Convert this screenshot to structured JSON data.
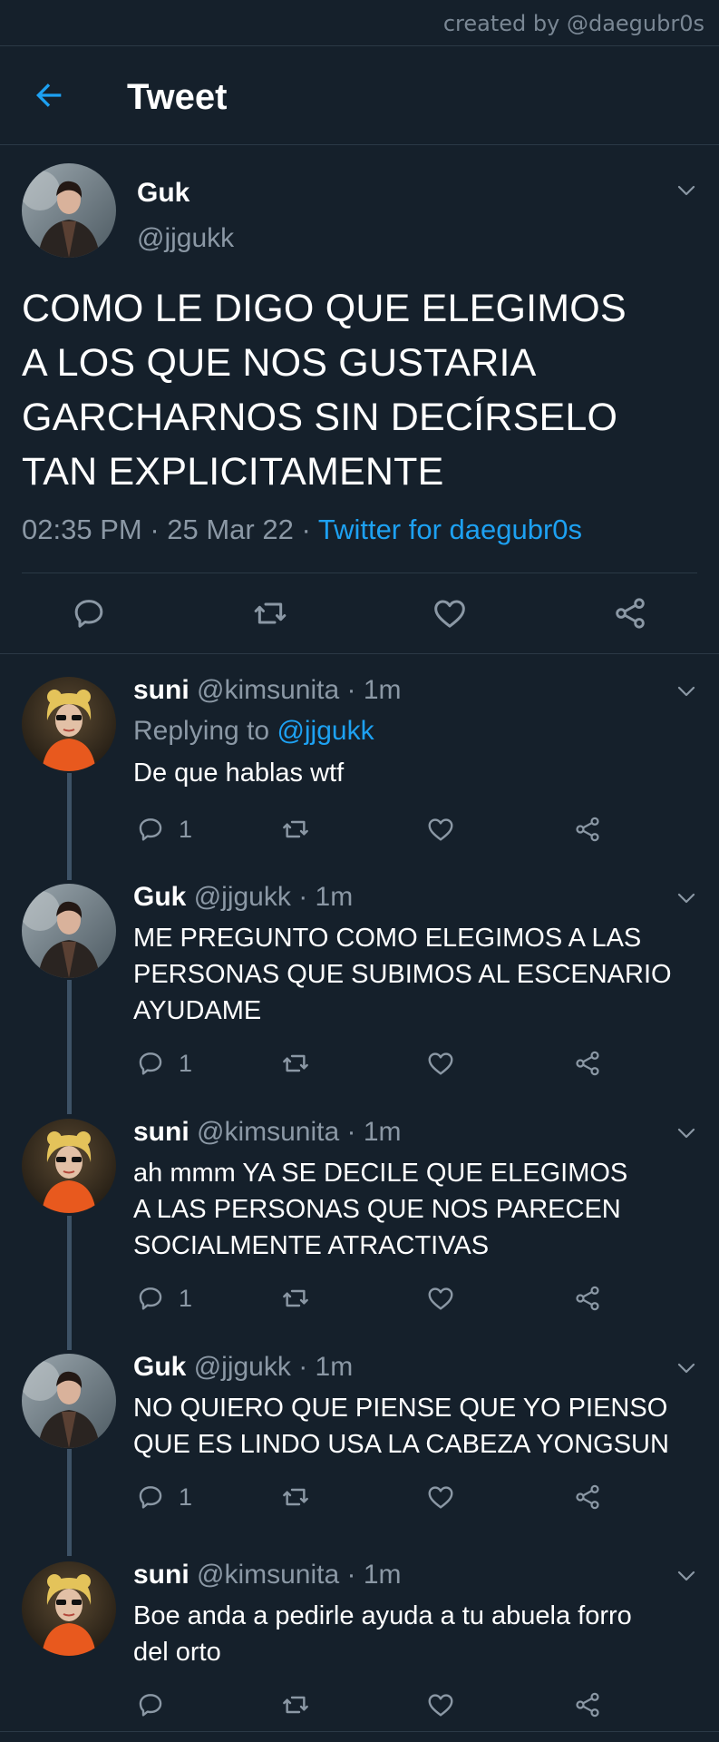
{
  "watermark": "created by @daegubr0s",
  "header": {
    "title": "Tweet"
  },
  "tweet": {
    "name": "Guk",
    "handle": "@jjgukk",
    "text": "COMO LE DIGO QUE ELEGIMOS\nA LOS QUE NOS GUSTARIA\nGARCHARNOS SIN DECÍRSELO\nTAN EXPLICITAMENTE",
    "time": "02:35 PM",
    "sep1": " · ",
    "date": "25 Mar 22",
    "sep2": " · ",
    "source": "Twitter for daegubr0s"
  },
  "replies": [
    {
      "name": "suni",
      "handle": "@kimsunita",
      "dot": " · ",
      "time": "1m",
      "replying_label": "Replying to ",
      "replying_to": "@jjgukk",
      "text": "De que hablas wtf",
      "reply_count": "1"
    },
    {
      "name": "Guk",
      "handle": "@jjgukk",
      "dot": " · ",
      "time": "1m",
      "text": "ME PREGUNTO COMO ELEGIMOS A LAS\nPERSONAS QUE SUBIMOS AL ESCENARIO\nAYUDAME",
      "reply_count": "1"
    },
    {
      "name": "suni",
      "handle": "@kimsunita",
      "dot": " · ",
      "time": "1m",
      "text": "ah mmm YA SE DECILE QUE ELEGIMOS\nA LAS PERSONAS QUE NOS PARECEN\nSOCIALMENTE ATRACTIVAS",
      "reply_count": "1"
    },
    {
      "name": "Guk",
      "handle": "@jjgukk",
      "dot": " · ",
      "time": "1m",
      "text": "NO QUIERO QUE PIENSE QUE YO PIENSO\nQUE ES LINDO USA LA CABEZA YONGSUN",
      "reply_count": "1"
    },
    {
      "name": "suni",
      "handle": "@kimsunita",
      "dot": " · ",
      "time": "1m",
      "text": "Boe anda a pedirle ayuda a tu abuela forro\ndel orto",
      "reply_count": ""
    }
  ],
  "icons": {
    "back": "arrow-left-icon",
    "reply": "speech-bubble-icon",
    "retweet": "retweet-icon",
    "like": "heart-icon",
    "share": "share-icon",
    "more": "chevron-down-icon"
  },
  "colors": {
    "background": "#15202b",
    "accent": "#1da1f2",
    "muted": "#8b98a5",
    "divider": "#2b3946",
    "thread": "#3d5266"
  }
}
